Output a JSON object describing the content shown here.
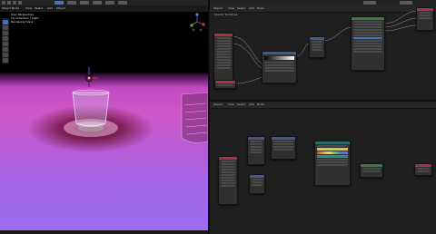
{
  "viewport": {
    "info_lines": [
      "User Perspective",
      "(1) Collection | Light",
      "Rendering Done"
    ],
    "header_items": [
      "Object Mode",
      "View",
      "Select",
      "Add",
      "Object"
    ]
  },
  "node_editor_top": {
    "header_items": [
      "Object",
      "View",
      "Select",
      "Add",
      "Node"
    ],
    "breadcrumb": "Shader Nodetree"
  },
  "node_editor_bottom": {
    "header_items": [
      "Object",
      "View",
      "Select",
      "Add",
      "Node"
    ]
  },
  "colors": {
    "accent": "#4772b3",
    "node_red": "#a53246",
    "node_teal": "#2e6a6a",
    "node_green": "#3e7a3e",
    "node_blue": "#3a5e8c"
  }
}
